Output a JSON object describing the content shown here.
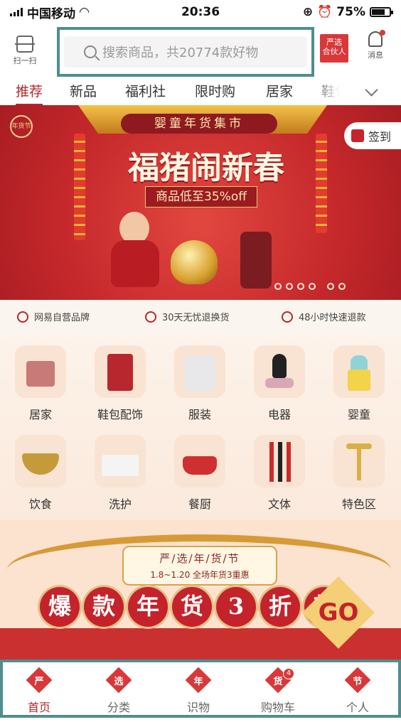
{
  "status_bar": {
    "carrier": "中国移动",
    "time": "20:36",
    "battery": "75%"
  },
  "header": {
    "scan_label": "扫一扫",
    "search_placeholder": "搜索商品，共20774款好物",
    "partner_line1": "严选",
    "partner_line2": "合伙人",
    "message_label": "消息"
  },
  "tabs": [
    {
      "label": "推荐",
      "active": true
    },
    {
      "label": "新品"
    },
    {
      "label": "福利社"
    },
    {
      "label": "限时购"
    },
    {
      "label": "居家"
    },
    {
      "label": "鞋包"
    }
  ],
  "banner": {
    "fair": "婴童年货集市",
    "headline": "福猪闹新春",
    "subline": "商品低至35%off",
    "signin_label": "签到",
    "logo_text": "年货节",
    "slide_count": 6
  },
  "promises": [
    {
      "icon": "brand-icon",
      "text": "网易自营品牌"
    },
    {
      "icon": "shield-check-icon",
      "text": "30天无忧退换货"
    },
    {
      "icon": "clock-refund-icon",
      "text": "48小时快速退款"
    }
  ],
  "categories": [
    {
      "label": "居家",
      "icon": "bedding-icon"
    },
    {
      "label": "鞋包配饰",
      "icon": "suitcase-icon"
    },
    {
      "label": "服装",
      "icon": "jacket-icon"
    },
    {
      "label": "电器",
      "icon": "vacuum-icon"
    },
    {
      "label": "婴童",
      "icon": "baby-bottle-icon"
    },
    {
      "label": "饮食",
      "icon": "noodle-bowl-icon"
    },
    {
      "label": "洗护",
      "icon": "tissue-box-icon"
    },
    {
      "label": "餐厨",
      "icon": "cast-pot-icon"
    },
    {
      "label": "文体",
      "icon": "pens-icon"
    },
    {
      "label": "特色区",
      "icon": "roller-icon"
    }
  ],
  "promo": {
    "plaque_title": "严/选/年/货/节",
    "plaque_sub": "1.8~1.20 全场年货3重惠",
    "slogan_chars": [
      "爆",
      "款",
      "年",
      "货",
      "3",
      "折",
      "起"
    ],
    "go_label": "GO"
  },
  "tabbar": [
    {
      "label": "首页",
      "glyph": "严",
      "active": true
    },
    {
      "label": "分类",
      "glyph": "选"
    },
    {
      "label": "识物",
      "glyph": "年"
    },
    {
      "label": "购物车",
      "glyph": "货",
      "badge": "4"
    },
    {
      "label": "个人",
      "glyph": "节"
    }
  ],
  "colors": {
    "brand_red": "#b4282d",
    "highlight_border": "#4f8e8f"
  }
}
